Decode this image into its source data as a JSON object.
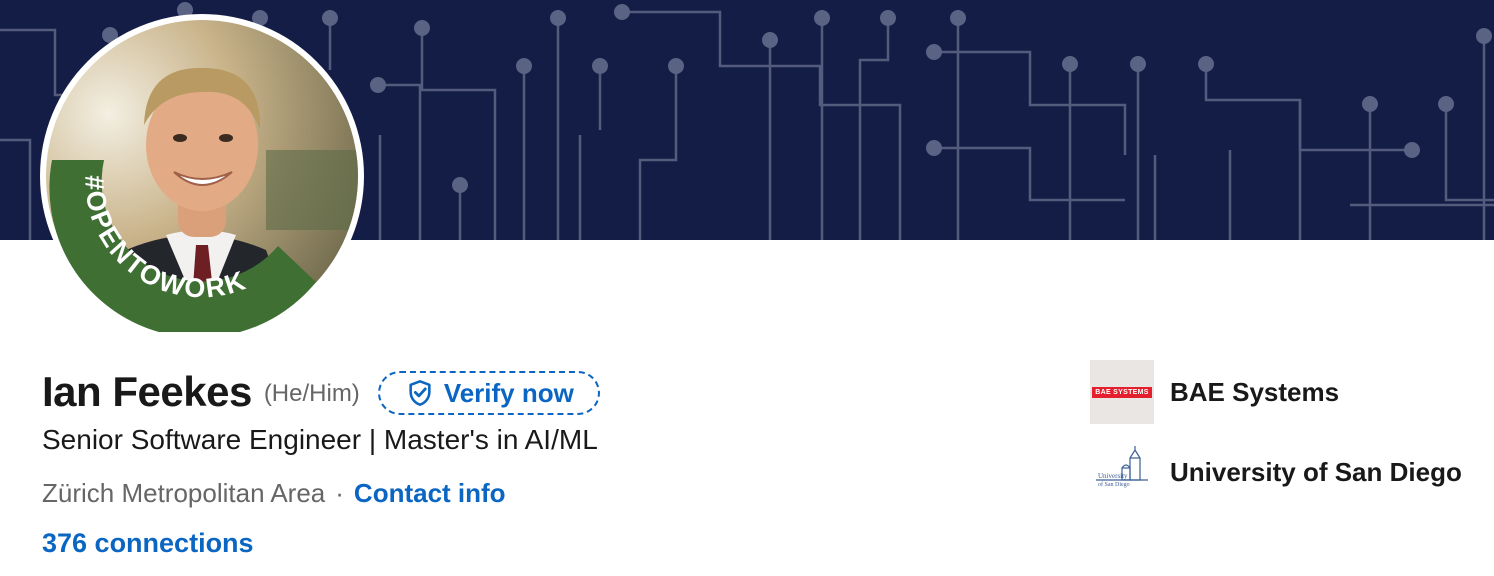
{
  "profile": {
    "name": "Ian Feekes",
    "pronouns": "(He/Him)",
    "verify_label": "Verify now",
    "headline": "Senior Software Engineer | Master's in AI/ML",
    "location": "Zürich Metropolitan Area",
    "separator": "·",
    "contact_label": "Contact info",
    "connections_label": "376 connections",
    "avatar_badge_text": "#OPENTOWORK"
  },
  "organizations": [
    {
      "name": "BAE Systems",
      "logo_text": "BAE SYSTEMS"
    },
    {
      "name": "University of San Diego",
      "logo_text": "University of San Diego"
    }
  ],
  "colors": {
    "banner": "#141d45",
    "link_blue": "#0a66c2",
    "open_to_work_green": "#3f6f32"
  },
  "icons": {
    "verify": "shield-check-icon"
  }
}
